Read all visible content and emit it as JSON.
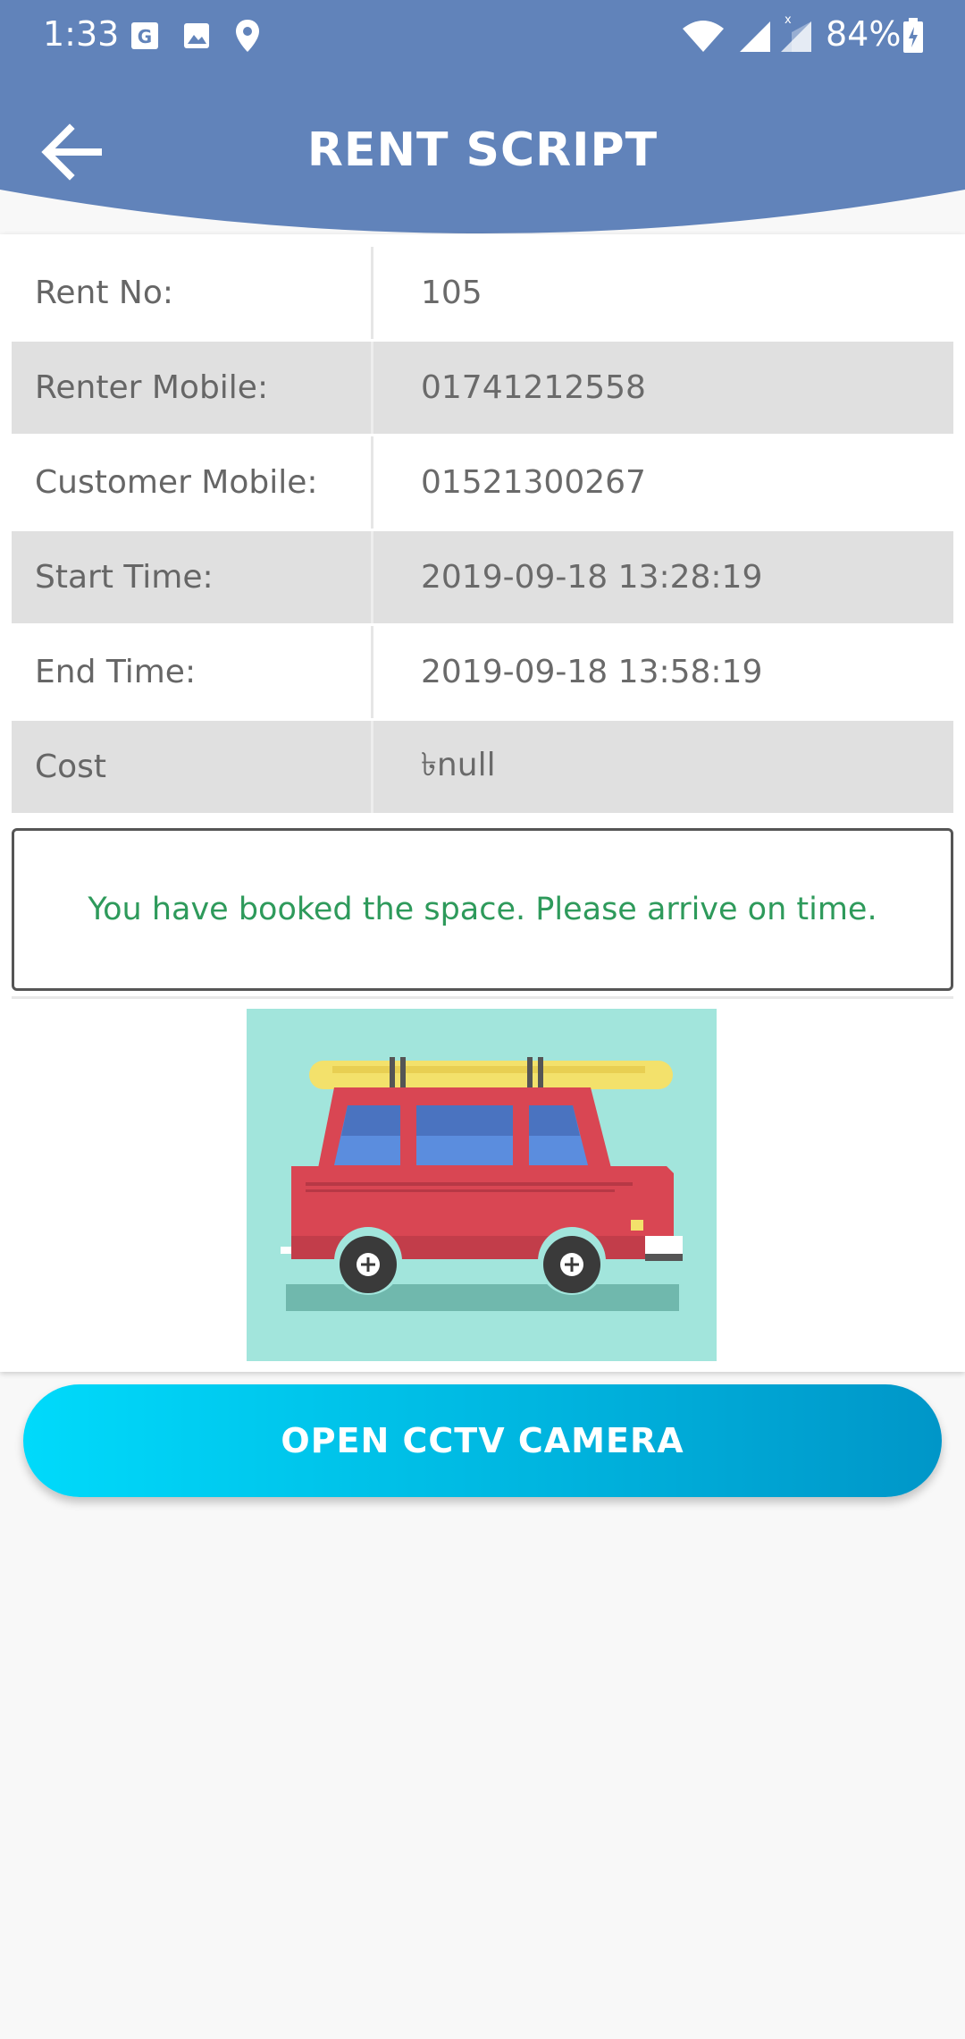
{
  "status_bar": {
    "time": "1:33",
    "battery": "84%",
    "icons": [
      "google-icon",
      "image-icon",
      "location-icon",
      "wifi-icon",
      "signal-icon",
      "signal-icon-no-data",
      "battery-charging-icon"
    ]
  },
  "header": {
    "title": "RENT SCRIPT",
    "back_icon": "arrow-left-icon",
    "background_color": "#6183ba"
  },
  "rent_info": {
    "rows": [
      {
        "label": "Rent No:",
        "value": "105"
      },
      {
        "label": "Renter Mobile:",
        "value": "01741212558"
      },
      {
        "label": "Customer Mobile:",
        "value": "01521300267"
      },
      {
        "label": "Start Time:",
        "value": "2019-09-18 13:28:19"
      },
      {
        "label": "End Time:",
        "value": "2019-09-18 13:58:19"
      },
      {
        "label": "Cost",
        "value": "৳null"
      }
    ]
  },
  "message": {
    "text": "You have booked the space. Please arrive on time.",
    "color": "#2e9a5b"
  },
  "illustration": {
    "icon": "car-illustration"
  },
  "actions": {
    "cctv_label": "OPEN CCTV CAMERA"
  }
}
